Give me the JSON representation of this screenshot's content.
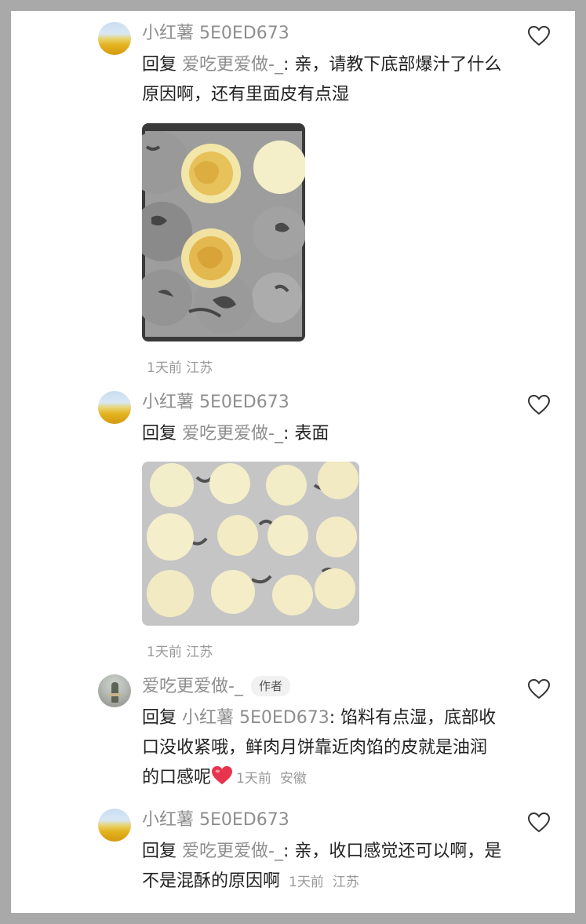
{
  "comments": [
    {
      "author": "小红薯 5E0ED673",
      "reply_prefix": "回复",
      "reply_to": "爱吃更爱做-_",
      "body": ": 亲，请教下底部爆汁了什么原因啊，还有里面皮有点湿",
      "time": "1天前",
      "location": "江苏",
      "avatar": "wheat-field-avatar",
      "has_photo": true
    },
    {
      "author": "小红薯 5E0ED673",
      "reply_prefix": "回复",
      "reply_to": "爱吃更爱做-_",
      "body": ": 表面",
      "time": "1天前",
      "location": "江苏",
      "avatar": "wheat-field-avatar",
      "has_photo": true
    },
    {
      "author": "爱吃更爱做-_",
      "badge": "作者",
      "reply_prefix": "回复",
      "reply_to": "小红薯 5E0ED673",
      "body": ": 馅料有点湿，底部收口没收紧哦，鲜肉月饼靠近肉馅的皮就是油润的口感呢",
      "time": "1天前",
      "location": "安徽",
      "avatar": "person-avatar",
      "emoji": "red-heart-emoji"
    },
    {
      "author": "小红薯 5E0ED673",
      "reply_prefix": "回复",
      "reply_to": "爱吃更爱做-_",
      "body": ": 亲，收口感觉还可以啊，是不是混酥的原因啊",
      "time": "1天前",
      "location": "江苏",
      "avatar": "wheat-field-avatar"
    }
  ],
  "colors": {
    "name_gray": "#8e8e8e",
    "body_text": "#222222",
    "heart_emoji": "#e8344e"
  }
}
